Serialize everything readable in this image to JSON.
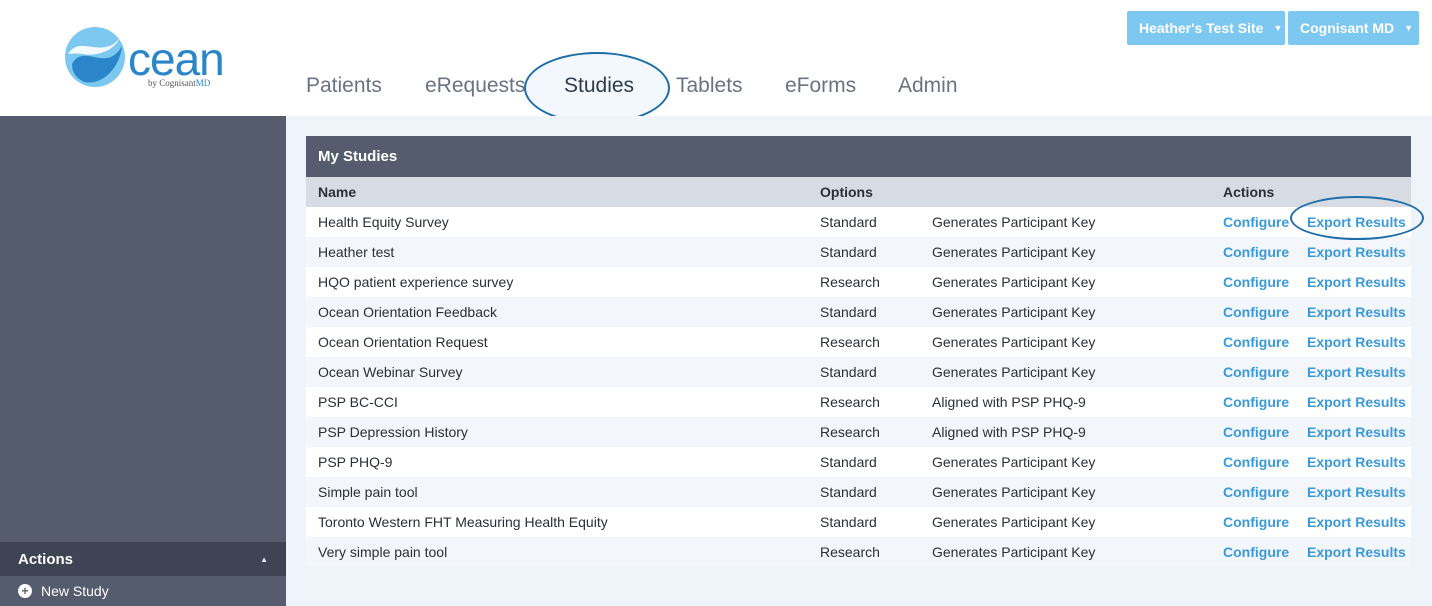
{
  "logo": {
    "word": "cean",
    "sub_prefix": "by Cognisant",
    "sub_suffix": "MD"
  },
  "nav": {
    "items": [
      {
        "label": "Patients"
      },
      {
        "label": "eRequests"
      },
      {
        "label": "Studies"
      },
      {
        "label": "Tablets"
      },
      {
        "label": "eForms"
      },
      {
        "label": "Admin"
      }
    ],
    "active": "Studies"
  },
  "top_buttons": {
    "site": "Heather's Test Site",
    "account": "Cognisant MD"
  },
  "sidebar": {
    "actions_title": "Actions",
    "new_study": "New Study"
  },
  "panel": {
    "title": "My Studies",
    "columns": {
      "name": "Name",
      "options": "Options",
      "actions": "Actions"
    },
    "action_labels": {
      "configure": "Configure",
      "export": "Export Results"
    },
    "rows": [
      {
        "name": "Health Equity Survey",
        "type": "Standard",
        "key": "Generates Participant Key"
      },
      {
        "name": "Heather test",
        "type": "Standard",
        "key": "Generates Participant Key"
      },
      {
        "name": "HQO patient experience survey",
        "type": "Research",
        "key": "Generates Participant Key"
      },
      {
        "name": "Ocean Orientation Feedback",
        "type": "Standard",
        "key": "Generates Participant Key"
      },
      {
        "name": "Ocean Orientation Request",
        "type": "Research",
        "key": "Generates Participant Key"
      },
      {
        "name": "Ocean Webinar Survey",
        "type": "Standard",
        "key": "Generates Participant Key"
      },
      {
        "name": "PSP BC-CCI",
        "type": "Research",
        "key": "Aligned with PSP PHQ-9"
      },
      {
        "name": "PSP Depression History",
        "type": "Research",
        "key": "Aligned with PSP PHQ-9"
      },
      {
        "name": "PSP PHQ-9",
        "type": "Standard",
        "key": "Generates Participant Key"
      },
      {
        "name": "Simple pain tool",
        "type": "Standard",
        "key": "Generates Participant Key"
      },
      {
        "name": "Toronto Western FHT Measuring Health Equity",
        "type": "Standard",
        "key": "Generates Participant Key"
      },
      {
        "name": "Very simple pain tool",
        "type": "Research",
        "key": "Generates Participant Key"
      }
    ]
  },
  "colors": {
    "accent": "#3a9ad9",
    "sidebar": "#555c6e",
    "top_button": "#7cc8f1",
    "annotation": "#1f6ea8"
  }
}
